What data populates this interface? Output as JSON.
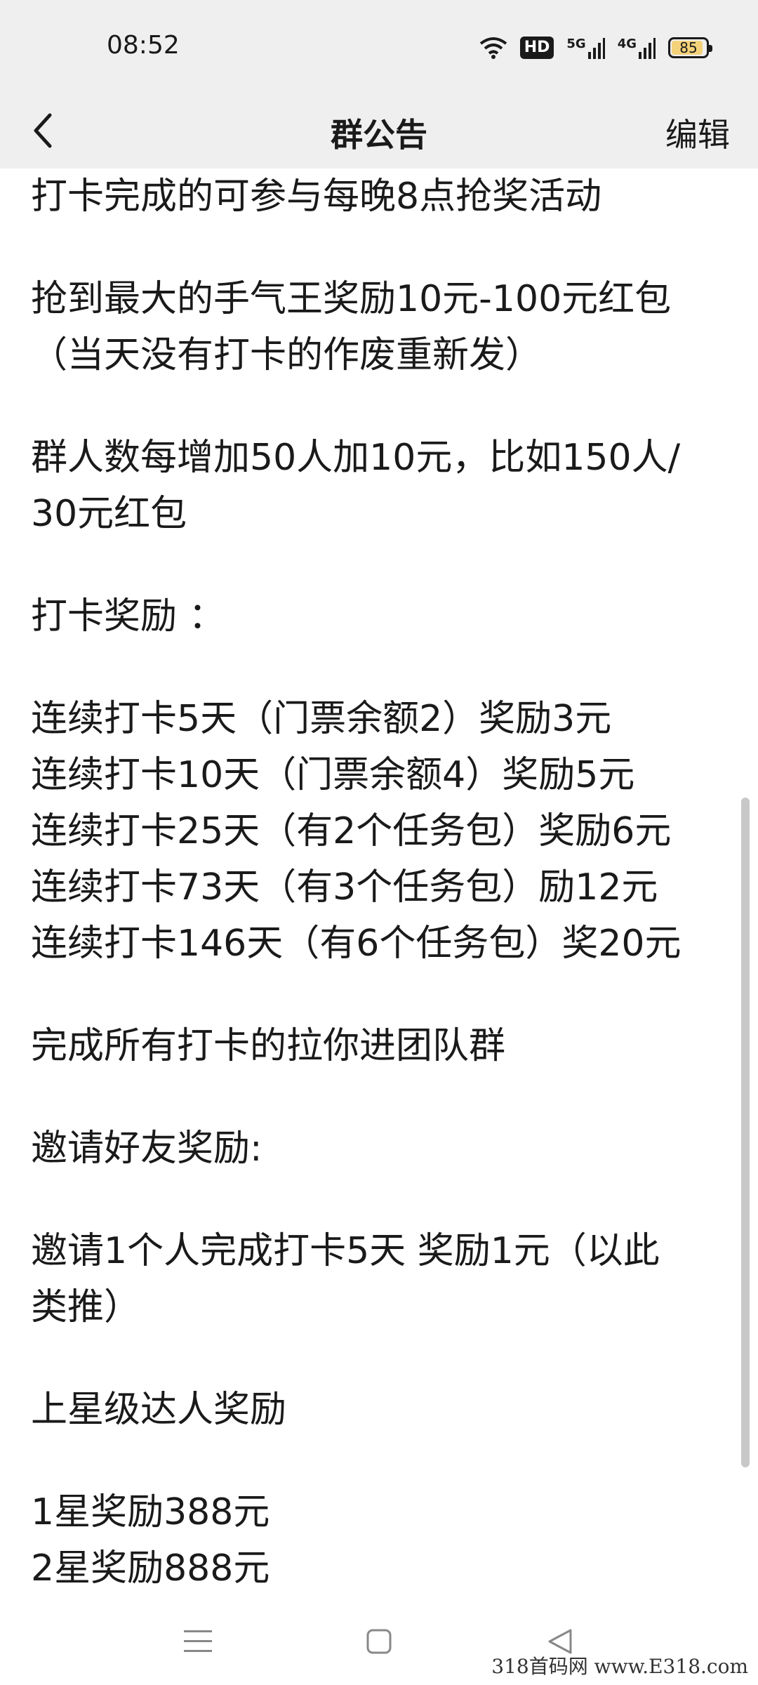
{
  "status_bar": {
    "time": "08:52",
    "hd_label": "HD",
    "network_5g": "5G",
    "network_4g": "4G",
    "battery_percent": 85,
    "battery_label": "85"
  },
  "nav": {
    "back_icon": "chevron-left-icon",
    "title": "群公告",
    "edit_label": "编辑"
  },
  "announcement": {
    "lines": [
      "  打卡完成的可参与每晚8点抢奖活动",
      "",
      "  抢到最大的手气王奖励10元-100元红包",
      "（当天没有打卡的作废重新发）",
      "",
      "群人数每增加50人加10元，比如150人/",
      "30元红包",
      "",
      "打卡奖励 ：",
      "",
      "连续打卡5天（门票余额2）奖励3元",
      "连续打卡10天（门票余额4）奖励5元",
      "连续打卡25天（有2个任务包）奖励6元",
      "连续打卡73天（有3个任务包）励12元",
      "连续打卡146天（有6个任务包）奖20元",
      "",
      "     完成所有打卡的拉你进团队群",
      "",
      "邀请好友奖励:",
      "",
      "邀请1个人完成打卡5天  奖励1元（以此",
      "类推）",
      "",
      "上星级达人奖励",
      "",
      "1星奖励388元",
      "2星奖励888元"
    ]
  },
  "system_nav": {
    "menu_icon": "menu-icon",
    "home_icon": "square-home-icon",
    "back_icon": "triangle-back-icon"
  },
  "watermark": "318首码网  www.E318.com"
}
